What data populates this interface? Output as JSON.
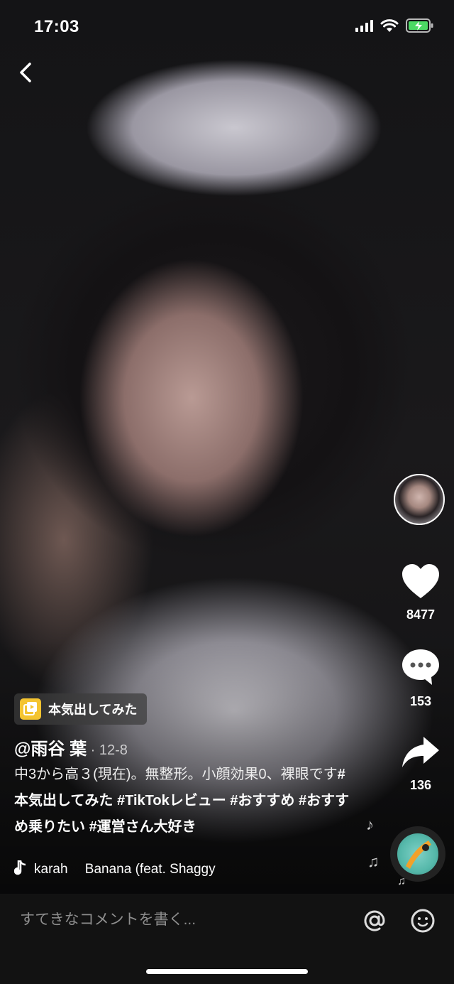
{
  "status_bar": {
    "time": "17:03"
  },
  "feature_tag": {
    "label": "本気出してみた"
  },
  "post": {
    "username": "@雨谷 葉",
    "date": " · 12-8",
    "caption_plain": "中3から高３(現在)。無整形。小顔効果0、裸眼です",
    "hashtags": [
      "#本気出してみた",
      "#TikTokレビュー",
      "#おすすめ",
      "#おすすめ乗りたい",
      "#運営さん大好き"
    ],
    "music": "karah　 Banana (feat. Shaggy"
  },
  "actions": {
    "likes": "8477",
    "comments": "153",
    "shares": "136"
  },
  "comment_bar": {
    "placeholder": "すてきなコメントを書く..."
  },
  "icons": {
    "back": "chevron-left-icon",
    "like": "heart-icon",
    "comment": "speech-bubble-icon",
    "share": "share-arrow-icon",
    "music": "music-note-icon",
    "mention": "at-icon",
    "emoji": "smiley-icon"
  },
  "colors": {
    "tag_icon": "#f4c430",
    "comment_bar": "#121212"
  }
}
